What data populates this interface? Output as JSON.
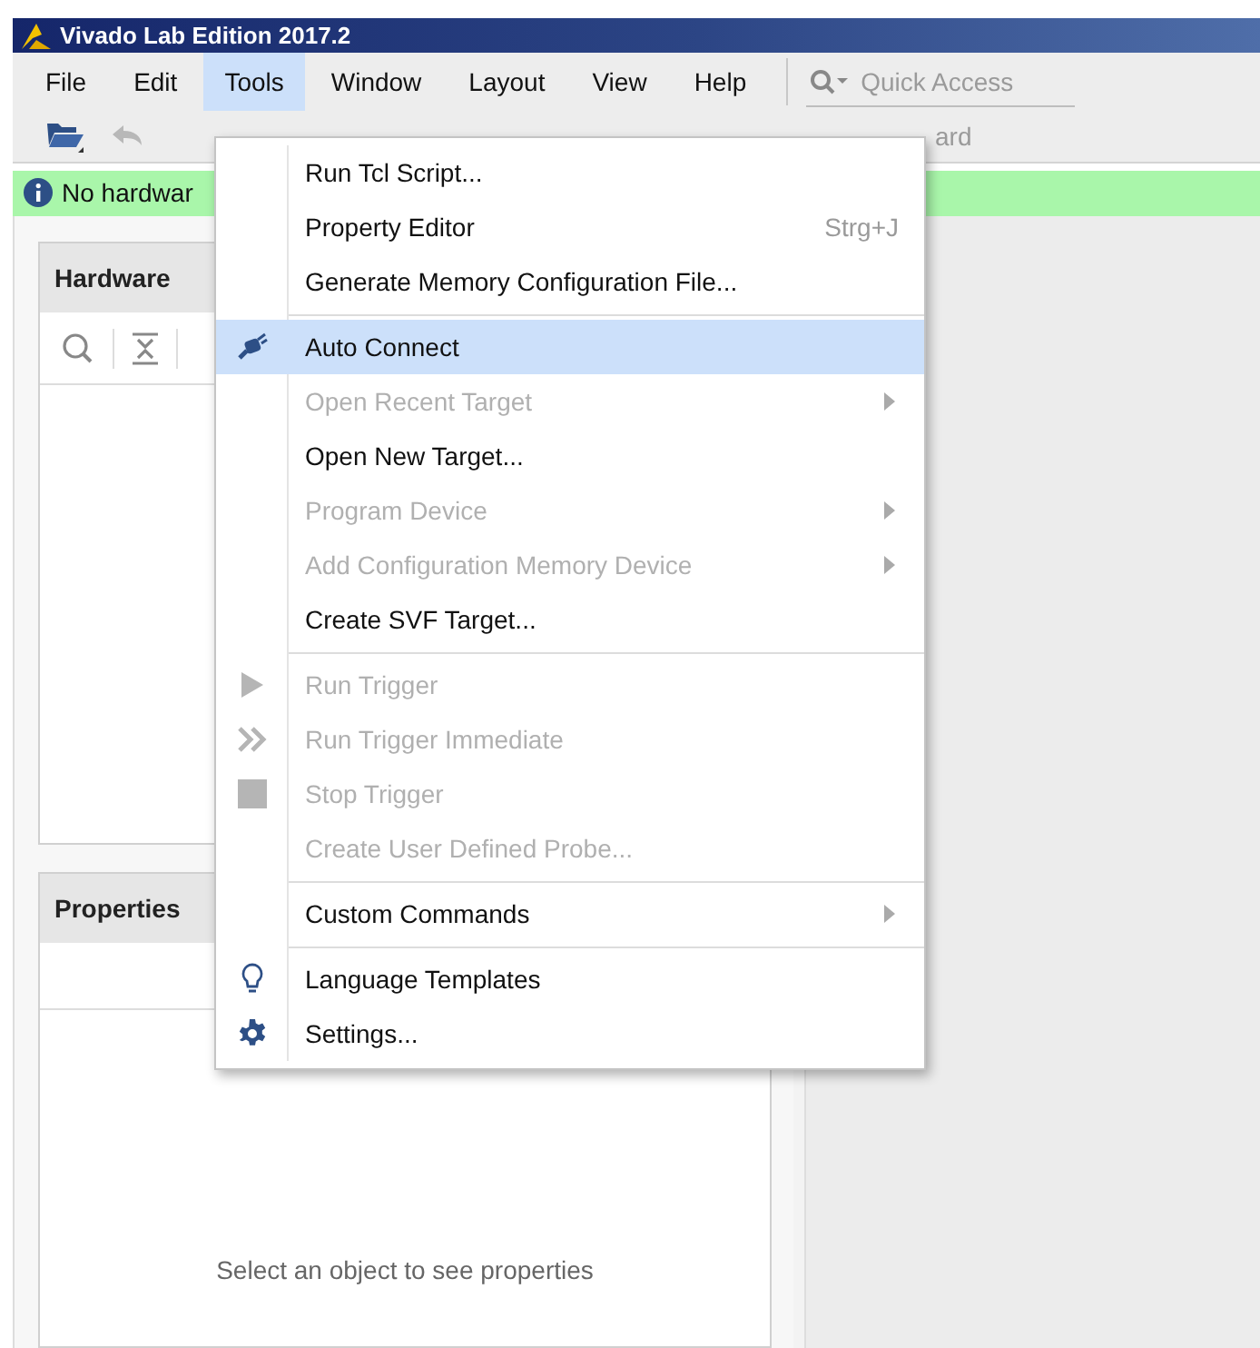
{
  "window": {
    "title": "Vivado Lab Edition 2017.2"
  },
  "menu_bar": [
    {
      "label": "File",
      "selected": false
    },
    {
      "label": "Edit",
      "selected": false
    },
    {
      "label": "Tools",
      "selected": true
    },
    {
      "label": "Window",
      "selected": false
    },
    {
      "label": "Layout",
      "selected": false
    },
    {
      "label": "View",
      "selected": false
    },
    {
      "label": "Help",
      "selected": false
    }
  ],
  "quick_access": {
    "placeholder": "Quick Access"
  },
  "toolbar": {
    "label": "ard"
  },
  "info_bar": {
    "text": "No hardwar"
  },
  "hardware_panel": {
    "title": "Hardware"
  },
  "properties_panel": {
    "title": "Properties",
    "empty_text": "Select an object to see properties"
  },
  "tools_menu": [
    {
      "kind": "item",
      "label": "Run Tcl Script...",
      "disabled": false,
      "selected": false
    },
    {
      "kind": "item",
      "label": "Property Editor",
      "shortcut": "Strg+J",
      "disabled": false,
      "selected": false
    },
    {
      "kind": "item",
      "label": "Generate Memory Configuration File...",
      "disabled": false,
      "selected": false
    },
    {
      "kind": "separator"
    },
    {
      "kind": "item",
      "label": "Auto Connect",
      "disabled": false,
      "selected": true
    },
    {
      "kind": "item",
      "label": "Open Recent Target",
      "submenu": true,
      "disabled": true,
      "selected": false
    },
    {
      "kind": "item",
      "label": "Open New Target...",
      "disabled": false,
      "selected": false
    },
    {
      "kind": "item",
      "label": "Program Device",
      "submenu": true,
      "disabled": true,
      "selected": false
    },
    {
      "kind": "item",
      "label": "Add Configuration Memory Device",
      "submenu": true,
      "disabled": true,
      "selected": false
    },
    {
      "kind": "item",
      "label": "Create SVF Target...",
      "disabled": false,
      "selected": false
    },
    {
      "kind": "separator"
    },
    {
      "kind": "item",
      "label": "Run Trigger",
      "disabled": true,
      "selected": false
    },
    {
      "kind": "item",
      "label": "Run Trigger Immediate",
      "disabled": true,
      "selected": false
    },
    {
      "kind": "item",
      "label": "Stop Trigger",
      "disabled": true,
      "selected": false
    },
    {
      "kind": "item",
      "label": "Create User Defined Probe...",
      "disabled": true,
      "selected": false
    },
    {
      "kind": "separator"
    },
    {
      "kind": "item",
      "label": "Custom Commands",
      "submenu": true,
      "disabled": false,
      "selected": false
    },
    {
      "kind": "separator"
    },
    {
      "kind": "item",
      "label": "Language Templates",
      "disabled": false,
      "selected": false
    },
    {
      "kind": "item",
      "label": "Settings...",
      "disabled": false,
      "selected": false
    }
  ]
}
